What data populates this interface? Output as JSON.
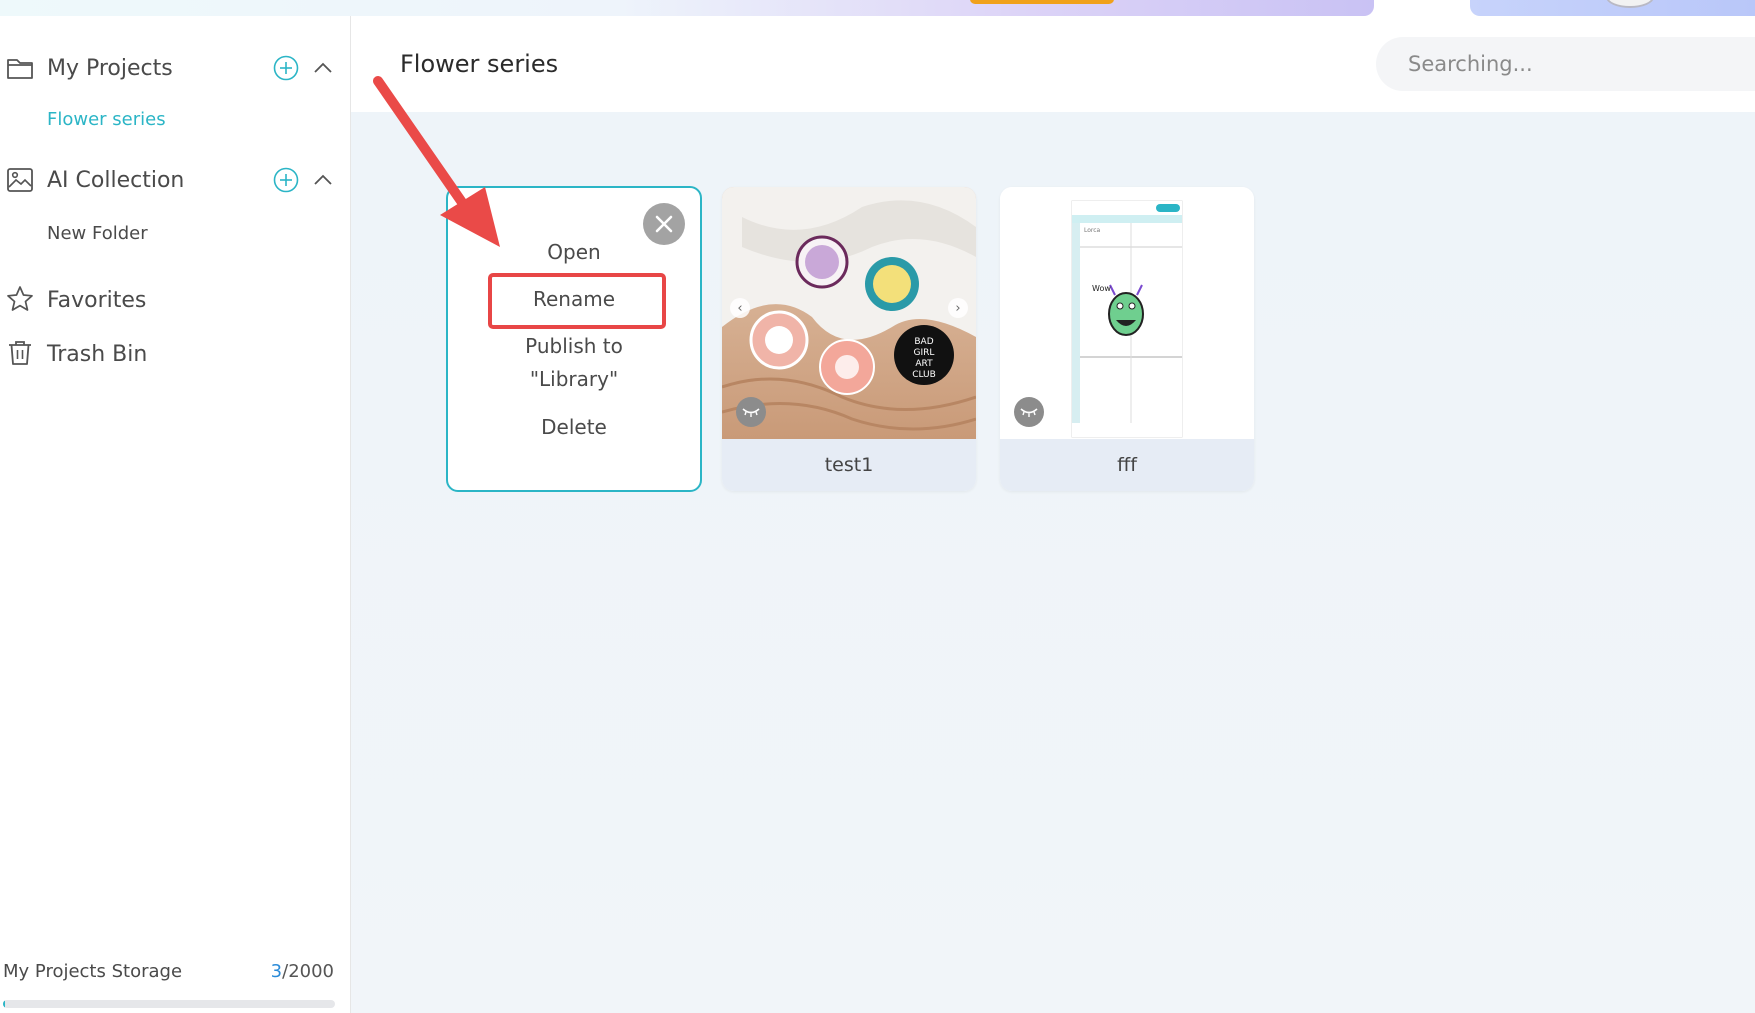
{
  "sidebar": {
    "my_projects": {
      "label": "My Projects",
      "subfolders": [
        "Flower series"
      ]
    },
    "ai_collection": {
      "label": "AI Collection",
      "subfolders": [
        "New Folder"
      ]
    },
    "favorites": "Favorites",
    "trash": "Trash Bin",
    "storage": {
      "label": "My Projects Storage",
      "used": "3",
      "total": "/2000",
      "fraction": 0.0015
    }
  },
  "header": {
    "title": "Flower series",
    "search_placeholder": "Searching..."
  },
  "context_menu": {
    "items": [
      "Open",
      "Rename",
      "Publish to",
      "\"Library\"",
      "Delete"
    ]
  },
  "projects": [
    {
      "name": "test1"
    },
    {
      "name": "fff"
    }
  ],
  "thumbnail_texts": {
    "pin_badge": [
      "BAD",
      "GIRL",
      "ART",
      "CLUB"
    ],
    "canvas_tab": "Lorca",
    "canvas_doodle": "Wow"
  },
  "colors": {
    "accent": "#2bb5c6",
    "highlight": "#e84646",
    "link_blue": "#2b8bd8"
  }
}
